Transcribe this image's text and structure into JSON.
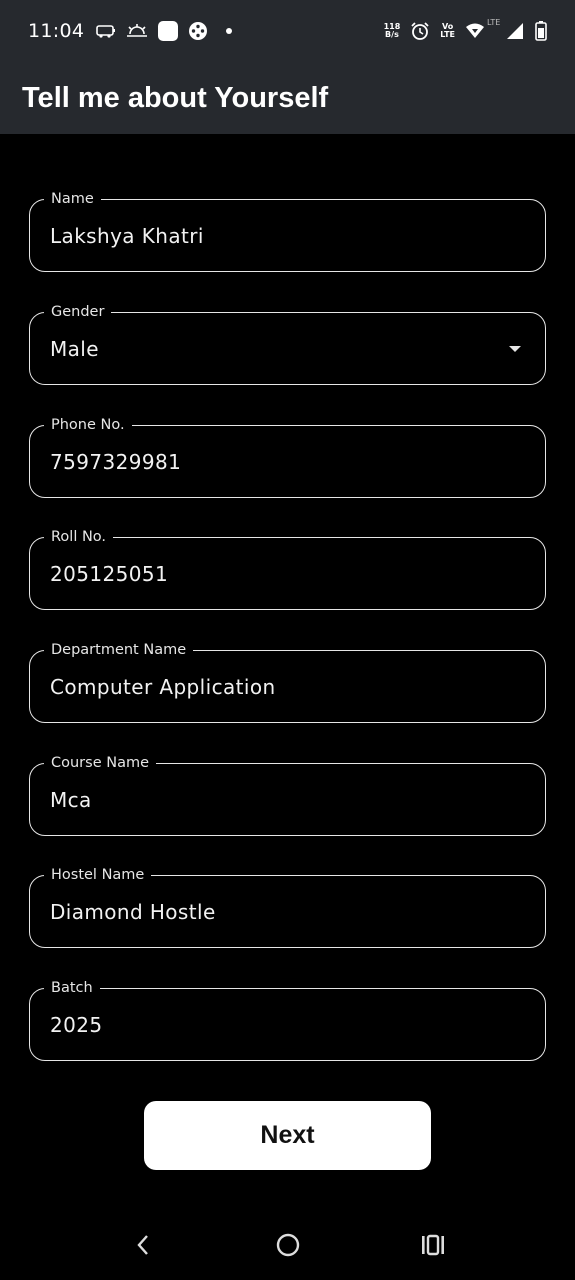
{
  "status_bar": {
    "time": "11:04",
    "speed_top": "118",
    "speed_bottom": "B/s",
    "volte_top": "Vo",
    "volte_bottom": "LTE",
    "lte": "LTE",
    "icons": [
      "ev-icon",
      "weather-icon",
      "app-square-icon",
      "game-icon",
      "notification-dot-icon",
      "data-speed-icon",
      "alarm-icon",
      "volte-icon",
      "wifi-icon",
      "lte-signal-icon",
      "battery-icon"
    ]
  },
  "app_bar": {
    "title": "Tell me about Yourself"
  },
  "form": {
    "name": {
      "label": "Name",
      "value": "Lakshya Khatri"
    },
    "gender": {
      "label": "Gender",
      "value": "Male"
    },
    "phone": {
      "label": "Phone No.",
      "value": "7597329981"
    },
    "roll": {
      "label": "Roll No.",
      "value": "205125051"
    },
    "department": {
      "label": "Department Name",
      "value": "Computer Application"
    },
    "course": {
      "label": "Course Name",
      "value": "Mca"
    },
    "hostel": {
      "label": "Hostel Name",
      "value": "Diamond Hostle"
    },
    "batch": {
      "label": "Batch",
      "value": "2025"
    },
    "next_label": "Next"
  },
  "nav": {
    "icons": [
      "back-icon",
      "home-icon",
      "recents-icon"
    ]
  },
  "colors": {
    "background": "#000000",
    "app_bar": "#26292e",
    "field_border": "#e6e6e6",
    "button": "#ffffff"
  }
}
